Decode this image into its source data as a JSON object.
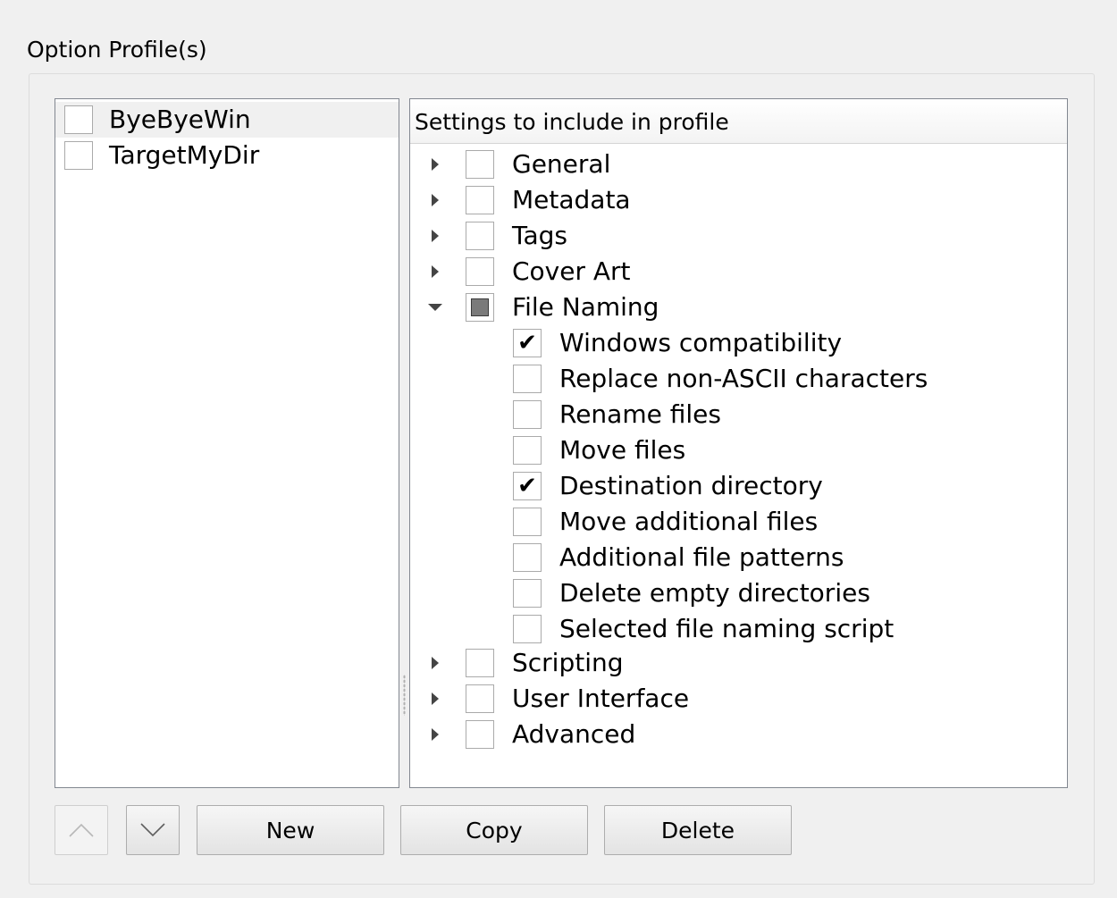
{
  "group": {
    "title": "Option Profile(s)"
  },
  "profiles": [
    {
      "label": "ByeByeWin",
      "checked": false,
      "selected": true
    },
    {
      "label": "TargetMyDir",
      "checked": false,
      "selected": false
    }
  ],
  "settings": {
    "header": "Settings to include in profile",
    "items": [
      {
        "label": "General",
        "expanded": false,
        "state": "unchecked"
      },
      {
        "label": "Metadata",
        "expanded": false,
        "state": "unchecked"
      },
      {
        "label": "Tags",
        "expanded": false,
        "state": "unchecked"
      },
      {
        "label": "Cover Art",
        "expanded": false,
        "state": "unchecked"
      },
      {
        "label": "File Naming",
        "expanded": true,
        "state": "partial"
      },
      {
        "label": "Scripting",
        "expanded": false,
        "state": "unchecked"
      },
      {
        "label": "User Interface",
        "expanded": false,
        "state": "unchecked"
      },
      {
        "label": "Advanced",
        "expanded": false,
        "state": "unchecked"
      }
    ],
    "file_naming_children": [
      {
        "label": "Windows compatibility",
        "checked": true
      },
      {
        "label": "Replace non-ASCII characters",
        "checked": false
      },
      {
        "label": "Rename files",
        "checked": false
      },
      {
        "label": "Move files",
        "checked": false
      },
      {
        "label": "Destination directory",
        "checked": true
      },
      {
        "label": "Move additional files",
        "checked": false
      },
      {
        "label": "Additional file patterns",
        "checked": false
      },
      {
        "label": "Delete empty directories",
        "checked": false
      },
      {
        "label": "Selected file naming script",
        "checked": false
      }
    ]
  },
  "buttons": {
    "move_up_icon": "chevron-up-icon",
    "move_down_icon": "chevron-down-icon",
    "new": "New",
    "copy": "Copy",
    "delete": "Delete"
  }
}
